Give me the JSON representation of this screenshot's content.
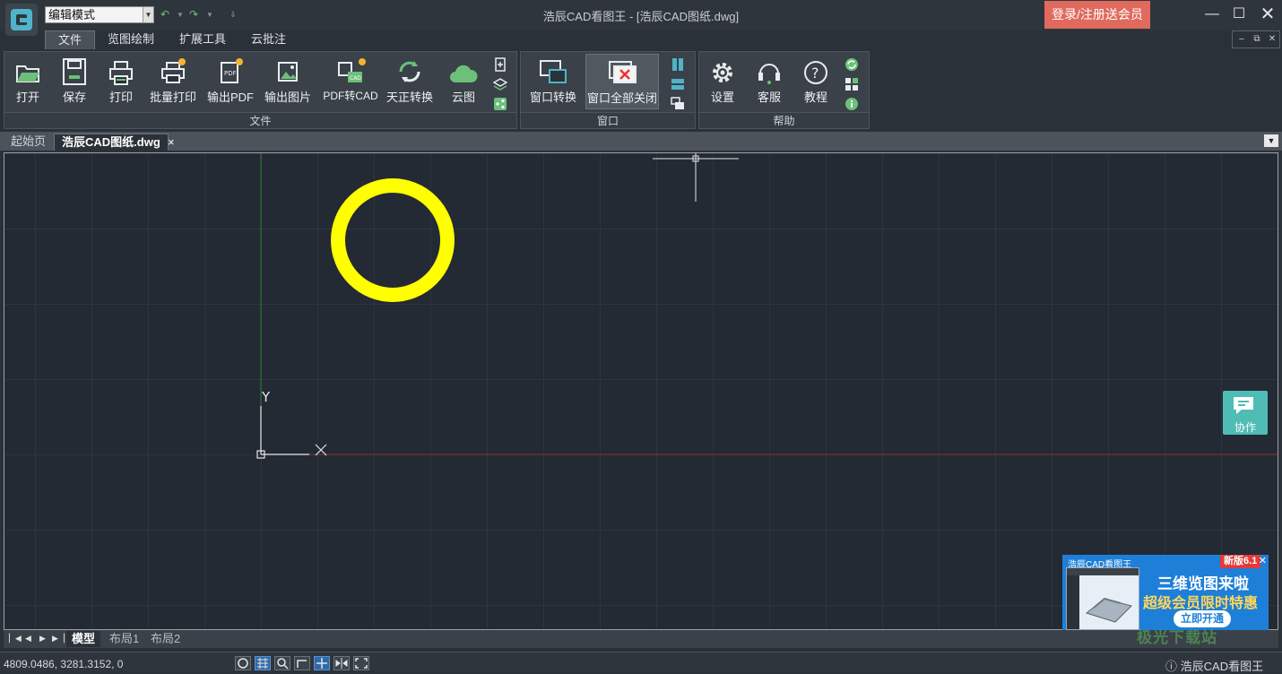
{
  "titlebar": {
    "mode_value": "编辑模式",
    "title": "浩辰CAD看图王 - [浩辰CAD图纸.dwg]",
    "login_label": "登录/注册送会员"
  },
  "ribbon_tabs": [
    "文件",
    "览图绘制",
    "扩展工具",
    "云批注"
  ],
  "ribbon": {
    "file_group": {
      "label": "文件",
      "buttons": [
        "打开",
        "保存",
        "打印",
        "批量打印",
        "输出PDF",
        "输出图片",
        "PDF转CAD",
        "天正转换",
        "云图"
      ]
    },
    "window_group": {
      "label": "窗口",
      "buttons": [
        "窗口转换",
        "窗口全部关闭"
      ]
    },
    "help_group": {
      "label": "帮助",
      "buttons": [
        "设置",
        "客服",
        "教程"
      ]
    }
  },
  "doc_tabs": {
    "start": "起始页",
    "active": "浩辰CAD图纸.dwg",
    "close": "×"
  },
  "canvas": {
    "circle_color": "#ffff00",
    "ucs_y": "Y",
    "ucs_x": "X"
  },
  "layout_tabs": [
    "模型",
    "布局1",
    "布局2"
  ],
  "status": {
    "coords": "4809.0486, 3281.3152, 0",
    "app_name": "浩辰CAD看图王"
  },
  "collab_label": "协作",
  "ad": {
    "brand": "浩辰CAD看图王",
    "version": "新版6.1",
    "headline": "三维览图来啦",
    "subline": "超级会员限时特惠",
    "cta": "立即开通"
  },
  "watermark": "极光下载站"
}
